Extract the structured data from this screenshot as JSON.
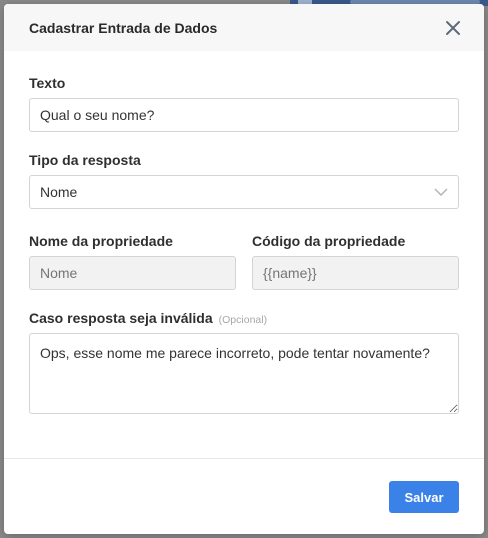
{
  "modal": {
    "title": "Cadastrar Entrada de Dados",
    "close_icon": "close-icon"
  },
  "form": {
    "texto": {
      "label": "Texto",
      "value": "Qual o seu nome?"
    },
    "tipo_resposta": {
      "label": "Tipo da resposta",
      "selected": "Nome",
      "icon": "chevron-down-icon"
    },
    "nome_propriedade": {
      "label": "Nome da propriedade",
      "placeholder": "Nome"
    },
    "codigo_propriedade": {
      "label": "Código da propriedade",
      "placeholder": "{{name}}"
    },
    "resposta_invalida": {
      "label": "Caso resposta seja inválida",
      "optional": "(Opcional)",
      "value": "Ops, esse nome me parece incorreto, pode tentar novamente?"
    }
  },
  "footer": {
    "save_label": "Salvar"
  },
  "colors": {
    "primary": "#3b82e8",
    "header_bg": "#f7f7f7",
    "disabled_bg": "#f2f2f2"
  }
}
